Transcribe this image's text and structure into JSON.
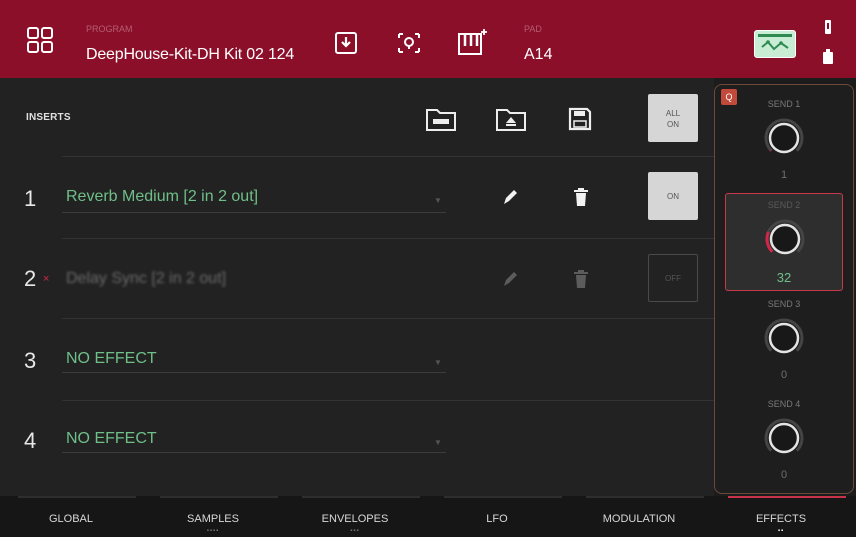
{
  "header": {
    "program_label": "PROGRAM",
    "program_name": "DeepHouse-Kit-DH Kit 02 124",
    "pad_label": "PAD",
    "pad_name": "A14"
  },
  "inserts": {
    "title": "INSERTS",
    "all_on_label_1": "ALL",
    "all_on_label_2": "ON",
    "slots": [
      {
        "number": "1",
        "effect": "Reverb Medium [2 in 2 out]",
        "state": "ON",
        "enabled": true
      },
      {
        "number": "2",
        "effect": "Delay Sync [2 in 2 out]",
        "state": "OFF",
        "enabled": false,
        "marker": "×"
      },
      {
        "number": "3",
        "effect": "NO EFFECT",
        "state": "",
        "enabled": false
      },
      {
        "number": "4",
        "effect": "NO EFFECT",
        "state": "",
        "enabled": false
      }
    ]
  },
  "sends": {
    "badge": "Q",
    "items": [
      {
        "label": "SEND 1",
        "value": "1",
        "level": 1,
        "active": false
      },
      {
        "label": "SEND 2",
        "value": "32",
        "level": 32,
        "active": true
      },
      {
        "label": "SEND 3",
        "value": "0",
        "level": 0,
        "active": false
      },
      {
        "label": "SEND 4",
        "value": "0",
        "level": 0,
        "active": false
      }
    ],
    "accent_color": "#d0264a"
  },
  "tabs": [
    {
      "label": "GLOBAL",
      "dots": "",
      "active": false
    },
    {
      "label": "SAMPLES",
      "dots": "▪▪▪▪",
      "active": false
    },
    {
      "label": "ENVELOPES",
      "dots": "▪▪▪",
      "active": false
    },
    {
      "label": "LFO",
      "dots": "",
      "active": false
    },
    {
      "label": "MODULATION",
      "dots": "",
      "active": false
    },
    {
      "label": "EFFECTS",
      "dots": "▪▪",
      "active": true
    }
  ],
  "colors": {
    "header": "#8c0f2a",
    "effect_text": "#6fbf88",
    "active_tab": "#c8324a"
  }
}
